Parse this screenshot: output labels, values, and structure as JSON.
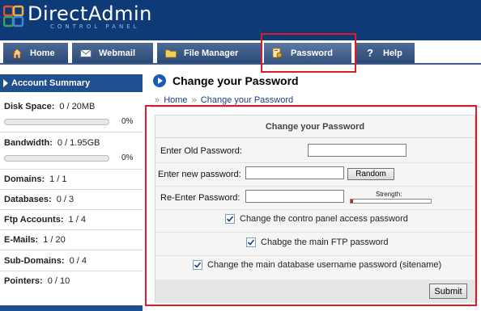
{
  "app": {
    "logo_title": "DirectAdmin",
    "logo_subtitle": "CONTROL PANEL"
  },
  "nav": {
    "tabs": [
      {
        "label": "Home",
        "icon": "home-icon"
      },
      {
        "label": "Webmail",
        "icon": "envelope-icon"
      },
      {
        "label": "File Manager",
        "icon": "folder-icon"
      },
      {
        "label": "Password",
        "icon": "key-icon",
        "active": true
      },
      {
        "label": "Help",
        "icon": "question-icon"
      }
    ]
  },
  "sidebar": {
    "title": "Account Summary",
    "disk": {
      "label": "Disk Space:",
      "value": "0 / 20MB",
      "percent": "0%",
      "fill": 0
    },
    "bandwidth": {
      "label": "Bandwidth:",
      "value": "0 / 1.95GB",
      "percent": "0%",
      "fill": 0
    },
    "items": [
      {
        "label": "Domains:",
        "value": "1 / 1"
      },
      {
        "label": "Databases:",
        "value": "0 / 3"
      },
      {
        "label": "Ftp Accounts:",
        "value": "1 / 4"
      },
      {
        "label": "E-Mails:",
        "value": "1 / 20"
      },
      {
        "label": "Sub-Domains:",
        "value": "0 / 4"
      },
      {
        "label": "Pointers:",
        "value": "0 / 10"
      }
    ]
  },
  "main": {
    "title": "Change your Password",
    "breadcrumb": [
      {
        "label": "Home"
      },
      {
        "label": "Change your Password"
      }
    ],
    "breadcrumb_sep": "»",
    "form": {
      "title": "Change your Password",
      "old_password_label": "Enter Old Password:",
      "old_password_value": "",
      "new_password_label": "Enter new password:",
      "new_password_value": "",
      "random_button": "Random",
      "reenter_label": "Re-Enter Password:",
      "reenter_value": "",
      "strength_label": "Strength:",
      "strength_level": 0.03,
      "checkboxes": [
        {
          "label": "Change the contro panel access password",
          "checked": true
        },
        {
          "label": "Chabge the main FTP password",
          "checked": true
        },
        {
          "label": "Change the main database username password (sitename)",
          "checked": true
        }
      ],
      "submit_button": "Submit"
    }
  },
  "colors": {
    "header_bg": "#0f3a78",
    "tab_bg": "#2c4a76",
    "sidebar_head": "#1f4f8e",
    "highlight": "#e01b24",
    "strength_weak": "#c71e1e"
  }
}
